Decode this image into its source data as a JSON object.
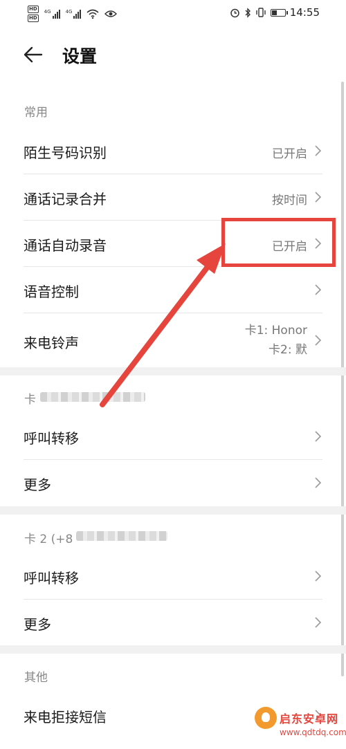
{
  "status_bar": {
    "hd1": "HD",
    "hd2": "HD",
    "net1": "4G",
    "net2": "4G",
    "time": "14:55",
    "battery_level": 0.35
  },
  "header": {
    "title": "设置"
  },
  "sections": {
    "common": {
      "label": "常用",
      "items": [
        {
          "label": "陌生号码识别",
          "value": "已开启"
        },
        {
          "label": "通话记录合并",
          "value": "按时间"
        },
        {
          "label": "通话自动录音",
          "value": "已开启"
        },
        {
          "label": "语音控制",
          "value": ""
        },
        {
          "label": "来电铃声",
          "value_line1": "卡1: Honor",
          "value_line2": "卡2: 默"
        }
      ]
    },
    "card1": {
      "label": "卡",
      "items": [
        {
          "label": "呼叫转移"
        },
        {
          "label": "更多"
        }
      ]
    },
    "card2": {
      "label": "卡 2 (+8",
      "items": [
        {
          "label": "呼叫转移"
        },
        {
          "label": "更多"
        }
      ]
    },
    "other": {
      "label": "其他",
      "items": [
        {
          "label": "来电拒接短信"
        }
      ]
    }
  },
  "watermark": {
    "name": "启东安卓网",
    "url": "www.qdtdq.com"
  },
  "colors": {
    "annotation_red": "#e5453c"
  }
}
